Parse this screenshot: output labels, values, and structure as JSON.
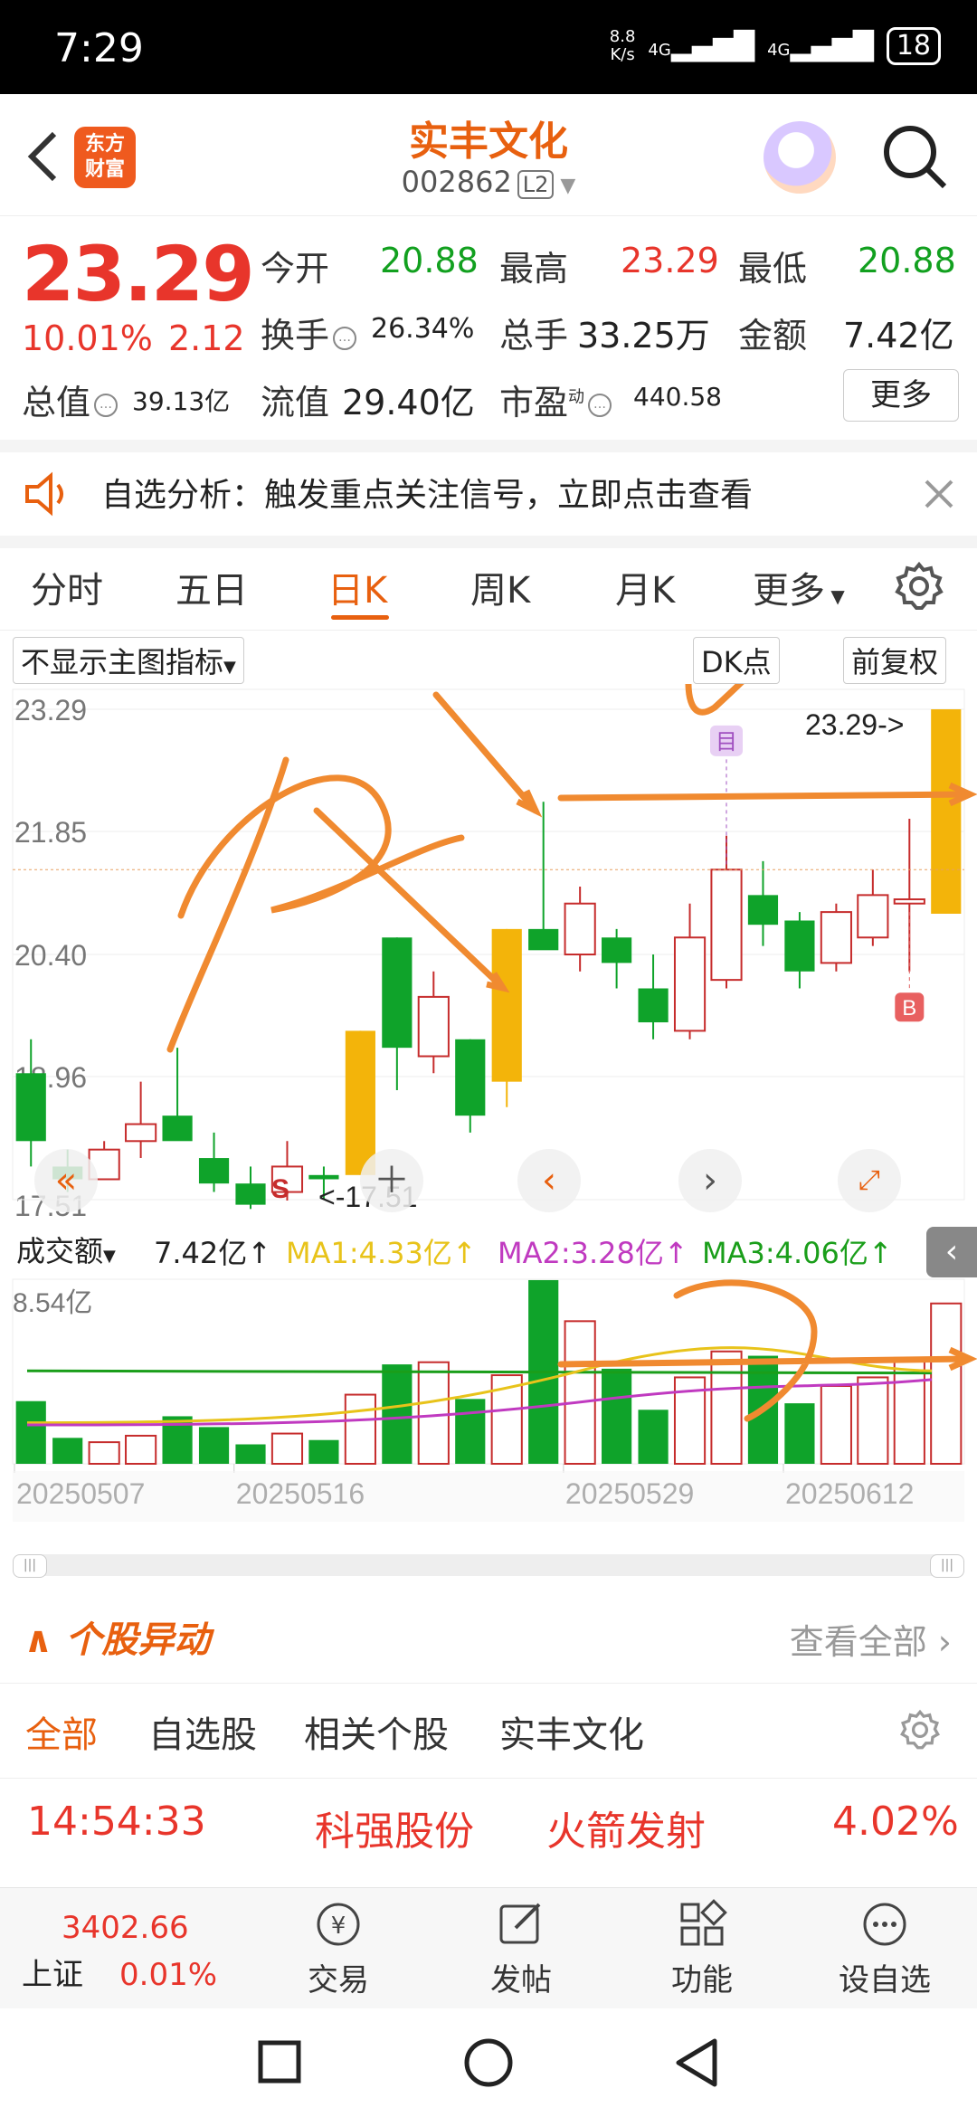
{
  "status": {
    "time": "7:29",
    "netspeed_value": "8.8",
    "netspeed_unit": "K/s",
    "sig1": "4G",
    "sig2": "4G",
    "battery": "18"
  },
  "header": {
    "logo_line1": "东方",
    "logo_line2": "财富",
    "name": "实丰文化",
    "code": "002862",
    "level": "L2"
  },
  "quote": {
    "price": "23.29",
    "change_pct": "10.01%",
    "change": "2.12",
    "open_label": "今开",
    "open": "20.88",
    "high_label": "最高",
    "high": "23.29",
    "low_label": "最低",
    "low": "20.88",
    "turnover_label": "换手",
    "turnover": "26.34%",
    "volume_label": "总手",
    "volume": "33.25万",
    "amount_label": "金额",
    "amount": "7.42亿",
    "mktcap_label": "总值",
    "mktcap": "39.13亿",
    "float_label": "流值",
    "float": "29.40亿",
    "pe_label": "市盈",
    "pe_sup": "动",
    "pe": "440.58",
    "more": "更多"
  },
  "notice": {
    "text": "自选分析：触发重点关注信号，立即点击查看"
  },
  "tabs": [
    "分时",
    "五日",
    "日K",
    "周K",
    "月K",
    "更多"
  ],
  "chart_toolbar": {
    "indicator": "不显示主图指标",
    "dk": "DK点",
    "adjust": "前复权"
  },
  "chart_data": {
    "type": "candlestick",
    "y_ticks": [
      "23.29",
      "21.85",
      "20.40",
      "18.96",
      "17.51"
    ],
    "ylim": [
      17.51,
      23.29
    ],
    "last_label": "23.29->",
    "low_label": "<-17.51",
    "markers": {
      "sell": "S",
      "buy": "B",
      "watch": "目"
    },
    "candles": [
      {
        "o": 19.0,
        "h": 19.4,
        "l": 17.9,
        "c": 18.2
      },
      {
        "o": 17.9,
        "h": 18.1,
        "l": 17.6,
        "c": 17.75
      },
      {
        "o": 17.75,
        "h": 18.2,
        "l": 17.75,
        "c": 18.1
      },
      {
        "o": 18.2,
        "h": 18.9,
        "l": 18.0,
        "c": 18.4
      },
      {
        "o": 18.5,
        "h": 19.3,
        "l": 18.4,
        "c": 18.2
      },
      {
        "o": 18.0,
        "h": 18.3,
        "l": 17.6,
        "c": 17.7
      },
      {
        "o": 17.7,
        "h": 17.9,
        "l": 17.4,
        "c": 17.45
      },
      {
        "o": 17.6,
        "h": 18.2,
        "l": 17.5,
        "c": 17.9
      },
      {
        "o": 17.8,
        "h": 17.9,
        "l": 17.52,
        "c": 17.75
      },
      {
        "o": 17.8,
        "h": 19.5,
        "l": 17.8,
        "c": 19.5
      },
      {
        "o": 20.6,
        "h": 20.6,
        "l": 18.8,
        "c": 19.3
      },
      {
        "o": 19.2,
        "h": 20.2,
        "l": 19.0,
        "c": 19.9
      },
      {
        "o": 19.4,
        "h": 19.4,
        "l": 18.3,
        "c": 18.5
      },
      {
        "o": 18.9,
        "h": 20.7,
        "l": 18.6,
        "c": 20.7
      },
      {
        "o": 20.7,
        "h": 22.2,
        "l": 20.5,
        "c": 20.45
      },
      {
        "o": 20.4,
        "h": 21.2,
        "l": 20.2,
        "c": 21.0
      },
      {
        "o": 20.6,
        "h": 20.7,
        "l": 20.0,
        "c": 20.3
      },
      {
        "o": 20.0,
        "h": 20.4,
        "l": 19.4,
        "c": 19.6
      },
      {
        "o": 19.5,
        "h": 21.0,
        "l": 19.4,
        "c": 20.6
      },
      {
        "o": 20.1,
        "h": 21.8,
        "l": 20.0,
        "c": 21.4
      },
      {
        "o": 21.1,
        "h": 21.5,
        "l": 20.5,
        "c": 20.75
      },
      {
        "o": 20.8,
        "h": 20.9,
        "l": 20.0,
        "c": 20.2
      },
      {
        "o": 20.3,
        "h": 21.0,
        "l": 20.2,
        "c": 20.9
      },
      {
        "o": 20.6,
        "h": 21.4,
        "l": 20.5,
        "c": 21.1
      },
      {
        "o": 21.0,
        "h": 22.0,
        "l": 20.2,
        "c": 21.05
      },
      {
        "o": 20.88,
        "h": 23.29,
        "l": 20.88,
        "c": 23.29
      }
    ],
    "volume": {
      "label": "成交额",
      "value": "7.42亿↑",
      "ma1": "MA1:4.33亿↑",
      "ma2": "MA2:3.28亿↑",
      "ma3": "MA3:4.06亿↑",
      "max_label": "8.54亿",
      "values": [
        2.9,
        1.2,
        1.0,
        1.3,
        2.2,
        1.7,
        0.9,
        1.4,
        1.1,
        3.2,
        4.6,
        4.7,
        3.0,
        4.1,
        8.5,
        6.6,
        4.4,
        2.5,
        4.0,
        5.2,
        5.0,
        2.8,
        3.6,
        4.0,
        4.9,
        7.42
      ]
    },
    "x_dates": [
      "20250507",
      "20250516",
      "20250529",
      "20250612"
    ],
    "colors": {
      "up": "#c62c2c",
      "down": "#0fa32a",
      "limit": "#f3b40a",
      "ma1": "#e8c31a",
      "ma2": "#c03ac0",
      "ma3": "#1a9e1a"
    }
  },
  "section": {
    "title": "个股异动",
    "view_all": "查看全部"
  },
  "subtabs": [
    "全部",
    "自选股",
    "相关个股",
    "实丰文化"
  ],
  "movement": {
    "time": "14:54:33",
    "stock": "科强股份",
    "event": "火箭发射",
    "pct": "4.02%"
  },
  "bottom": {
    "index_value": "3402.66",
    "index_name": "上证",
    "index_pct": "0.01%",
    "trade": "交易",
    "post": "发帖",
    "func": "功能",
    "watch": "设自选"
  }
}
